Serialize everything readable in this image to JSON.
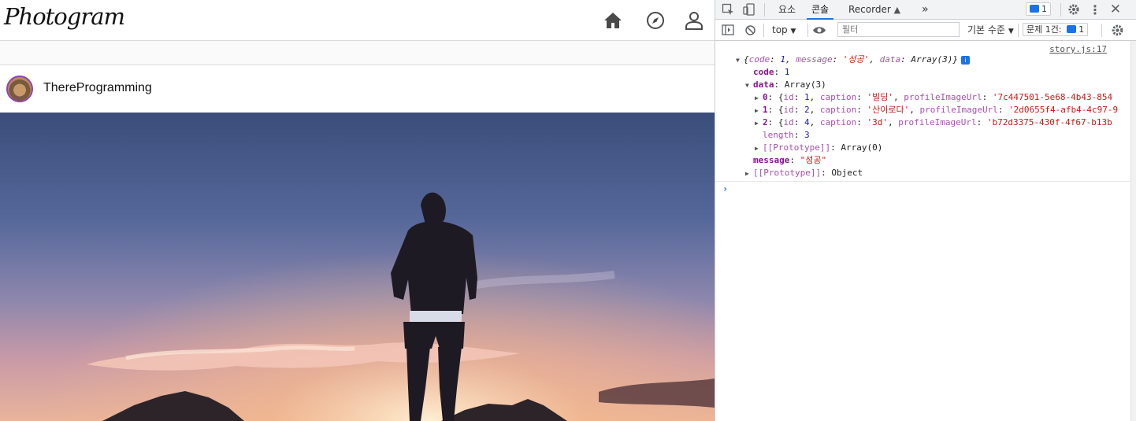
{
  "app": {
    "logo": "Photogram",
    "nav": [
      "home-icon",
      "explore-icon",
      "profile-icon"
    ],
    "post": {
      "username": "ThereProgramming"
    }
  },
  "devtools": {
    "tabs": [
      "요소",
      "콘솔",
      "Recorder"
    ],
    "active_tab": "콘솔",
    "more_tabs": "»",
    "issues_badge": "1",
    "context": "top",
    "filter_placeholder": "필터",
    "level": "기본 수준",
    "issues_label": "문제 1건:",
    "issues_count": "1",
    "source_link": "story.js:17",
    "log": {
      "summary": {
        "open": "{",
        "k_code": "code",
        "v_code": "1",
        "k_message": "message",
        "v_message": "'성공'",
        "k_data": "data",
        "v_data": "Array(3)",
        "close": "}"
      },
      "code_key": "code",
      "code_val": "1",
      "data_key": "data",
      "data_val": "Array(3)",
      "items": [
        {
          "idx": "0",
          "id": "1",
          "caption": "'빌딩'",
          "url": "'7c447501-5e68-4b43-854"
        },
        {
          "idx": "1",
          "id": "2",
          "caption": "'산이로다'",
          "url": "'2d0655f4-afb4-4c97-9"
        },
        {
          "idx": "2",
          "id": "4",
          "caption": "'3d'",
          "url": "'b72d3375-430f-4f67-b13b"
        }
      ],
      "length_key": "length",
      "length_val": "3",
      "proto_array": "[[Prototype]]",
      "proto_array_val": "Array(0)",
      "message_key": "message",
      "message_val": "\"성공\"",
      "proto_obj": "[[Prototype]]",
      "proto_obj_val": "Object"
    }
  }
}
